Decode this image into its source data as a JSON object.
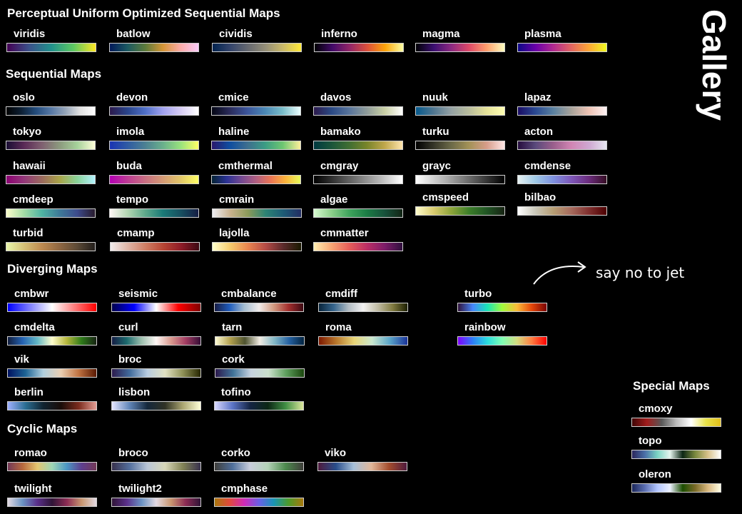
{
  "title": "Gallery",
  "annotation": "say no to jet",
  "sections": {
    "perceptual": "Perceptual Uniform Optimized Sequential Maps",
    "sequential": "Sequential Maps",
    "diverging": "Diverging Maps",
    "cyclic": "Cyclic Maps",
    "special": "Special Maps"
  },
  "colormaps": [
    {
      "name": "viridis",
      "colors": [
        "#440154",
        "#3b528b",
        "#21918c",
        "#5ec962",
        "#fde725"
      ]
    },
    {
      "name": "batlow",
      "colors": [
        "#011959",
        "#1c5a62",
        "#5c7b3b",
        "#d59537",
        "#fbaba8",
        "#faccfa"
      ]
    },
    {
      "name": "cividis",
      "colors": [
        "#00224e",
        "#35456c",
        "#666970",
        "#958f78",
        "#cbba69",
        "#fee838"
      ]
    },
    {
      "name": "inferno",
      "colors": [
        "#000004",
        "#420a68",
        "#932667",
        "#dd513a",
        "#fca50a",
        "#fcffa4"
      ]
    },
    {
      "name": "magma",
      "colors": [
        "#000004",
        "#3b0f70",
        "#8c2981",
        "#de4968",
        "#fe9f6d",
        "#fcfdbf"
      ]
    },
    {
      "name": "plasma",
      "colors": [
        "#0d0887",
        "#6a00a8",
        "#b12a90",
        "#e16462",
        "#fca636",
        "#f0f921"
      ]
    },
    {
      "name": "oslo",
      "colors": [
        "#010101",
        "#0d1f33",
        "#234c7c",
        "#5577a4",
        "#95a4b8",
        "#e2e2e2",
        "#ffffff"
      ]
    },
    {
      "name": "devon",
      "colors": [
        "#2c1a4c",
        "#29448a",
        "#4f6fc7",
        "#a1a2ef",
        "#d6ccf4",
        "#ffffff"
      ]
    },
    {
      "name": "cmice",
      "colors": [
        "#040613",
        "#2a2b5a",
        "#3c559b",
        "#4a87b5",
        "#79bdc9",
        "#eafdfd"
      ]
    },
    {
      "name": "davos",
      "colors": [
        "#2c1a4c",
        "#2b4a85",
        "#58749b",
        "#8f9c9a",
        "#c9d0a5",
        "#fefefe"
      ]
    },
    {
      "name": "nuuk",
      "colors": [
        "#05598c",
        "#507690",
        "#95a2a4",
        "#b9bd9d",
        "#e6e39a",
        "#fefeb2"
      ]
    },
    {
      "name": "lapaz",
      "colors": [
        "#1a0c64",
        "#2a4a92",
        "#5a81a0",
        "#a7a29a",
        "#eec3b4",
        "#fef2f3"
      ]
    },
    {
      "name": "tokyo",
      "colors": [
        "#1a0e34",
        "#5a2a56",
        "#7f6070",
        "#8c9a7e",
        "#a6d19a",
        "#fefed8"
      ]
    },
    {
      "name": "imola",
      "colors": [
        "#1a33b3",
        "#2f5ba3",
        "#4c8093",
        "#6ab08c",
        "#98e27d",
        "#ffff66"
      ]
    },
    {
      "name": "haline",
      "colors": [
        "#2a186c",
        "#0e4da0",
        "#3d6e8f",
        "#3b9c84",
        "#6dc671",
        "#fdef9a"
      ]
    },
    {
      "name": "bamako",
      "colors": [
        "#003940",
        "#1b553a",
        "#406e32",
        "#79852a",
        "#c0a74c",
        "#ffe5ad"
      ]
    },
    {
      "name": "turku",
      "colors": [
        "#000000",
        "#353528",
        "#6c6a48",
        "#a49257",
        "#d79d8a",
        "#ffe6e6"
      ]
    },
    {
      "name": "acton",
      "colors": [
        "#260d3e",
        "#5a4a7c",
        "#9a5f8c",
        "#d185b3",
        "#cfa7d1",
        "#e6e6f0"
      ]
    },
    {
      "name": "hawaii",
      "colors": [
        "#8c0273",
        "#94387a",
        "#9b6a5e",
        "#a9a449",
        "#8ad39a",
        "#b3f2fd"
      ]
    },
    {
      "name": "buda",
      "colors": [
        "#b301b3",
        "#bd3c94",
        "#c86f82",
        "#d49a75",
        "#e2c769",
        "#ffff66"
      ]
    },
    {
      "name": "cmthermal",
      "colors": [
        "#042333",
        "#2c3395",
        "#744992",
        "#b15f82",
        "#eb7655",
        "#fbb43c",
        "#e8fa5b"
      ]
    },
    {
      "name": "cmgray",
      "colors": [
        "#000000",
        "#3d3d3d",
        "#7a7a7a",
        "#b8b8b8",
        "#ffffff"
      ]
    },
    {
      "name": "grayc",
      "colors": [
        "#ffffff",
        "#b0b0b0",
        "#5a5a5a",
        "#000000"
      ]
    },
    {
      "name": "cmdense",
      "colors": [
        "#e6f1f1",
        "#9fc9e6",
        "#7f92e0",
        "#7e58b9",
        "#6c2d7e",
        "#360e24"
      ]
    },
    {
      "name": "cmdeep",
      "colors": [
        "#fdfecc",
        "#a3dca5",
        "#4fb4a3",
        "#3e7a98",
        "#3d4b8c",
        "#281a2c"
      ]
    },
    {
      "name": "tempo",
      "colors": [
        "#fff6f4",
        "#b3d6b2",
        "#5ea98b",
        "#1a7a77",
        "#175060",
        "#151d44"
      ]
    },
    {
      "name": "cmrain",
      "colors": [
        "#eeedf2",
        "#c9b28e",
        "#8b9a5a",
        "#2c8374",
        "#1d5b75",
        "#222d63"
      ]
    },
    {
      "name": "algae",
      "colors": [
        "#d7f9d0",
        "#8ccf8a",
        "#3fa35d",
        "#1b7c45",
        "#17513b",
        "#122414"
      ]
    },
    {
      "name": "cmspeed",
      "colors": [
        "#fffdcd",
        "#d9cb6f",
        "#8da43a",
        "#3c7e29",
        "#205524",
        "#172313"
      ]
    },
    {
      "name": "bilbao",
      "colors": [
        "#ffffff",
        "#c9c7b8",
        "#b69e74",
        "#a66b5d",
        "#80302f",
        "#4d0001"
      ]
    },
    {
      "name": "turbid",
      "colors": [
        "#e9f6ab",
        "#d5c076",
        "#be8a50",
        "#8f6742",
        "#5c4a36",
        "#221e1b"
      ]
    },
    {
      "name": "cmamp",
      "colors": [
        "#f1ecec",
        "#deb3a4",
        "#cd7c62",
        "#b64433",
        "#8d1b27",
        "#3c0912"
      ]
    },
    {
      "name": "lajolla",
      "colors": [
        "#ffffcc",
        "#f6ca6c",
        "#e9844f",
        "#b54b46",
        "#5a2a2b",
        "#1a1a00"
      ]
    },
    {
      "name": "cmmatter",
      "colors": [
        "#feedb0",
        "#f8a574",
        "#e65d59",
        "#bb2e65",
        "#7d1d69",
        "#2f0f3d"
      ]
    },
    {
      "name": "cmbwr",
      "colors": [
        "#0000ff",
        "#7f7fff",
        "#ffffff",
        "#ff7f7f",
        "#ff0000"
      ]
    },
    {
      "name": "seismic",
      "colors": [
        "#00004c",
        "#0000ff",
        "#ffffff",
        "#ff0000",
        "#7f0000"
      ]
    },
    {
      "name": "cmbalance",
      "colors": [
        "#181c43",
        "#1f5cbc",
        "#a5bdd1",
        "#f1eceb",
        "#d19a80",
        "#a42f2e",
        "#3c0912"
      ]
    },
    {
      "name": "cmdiff",
      "colors": [
        "#08243b",
        "#36658c",
        "#b1bbc3",
        "#f3f2f2",
        "#c1bca4",
        "#817b41",
        "#1c1f01"
      ]
    },
    {
      "name": "turbo",
      "colors": [
        "#30123b",
        "#4686fb",
        "#1ae4b6",
        "#a2fc3c",
        "#fabb39",
        "#e4460a",
        "#7a0403"
      ]
    },
    {
      "name": "cmdelta",
      "colors": [
        "#111d3d",
        "#2563b2",
        "#63b8c6",
        "#fffdcd",
        "#b5b63c",
        "#2d7a19",
        "#172313"
      ]
    },
    {
      "name": "curl",
      "colors": [
        "#151d44",
        "#1c6a6d",
        "#9dc0ae",
        "#fef6f4",
        "#d99a8f",
        "#a23d62",
        "#340d35"
      ]
    },
    {
      "name": "tarn",
      "colors": [
        "#fdfbd4",
        "#b3a14e",
        "#4e5330",
        "#f2ece3",
        "#82b7c5",
        "#2460a1",
        "#02233f"
      ]
    },
    {
      "name": "roma",
      "colors": [
        "#7e1900",
        "#b9792d",
        "#e8d578",
        "#cbe8ce",
        "#5ba6c9",
        "#1a3399"
      ]
    },
    {
      "name": "rainbow",
      "colors": [
        "#8000ff",
        "#2c7ef7",
        "#2adddd",
        "#80ffb4",
        "#d4dd80",
        "#ff7e41",
        "#ff0000"
      ]
    },
    {
      "name": "vik",
      "colors": [
        "#001261",
        "#1d6495",
        "#b0cfde",
        "#eacfb3",
        "#c07342",
        "#591902"
      ]
    },
    {
      "name": "broc",
      "colors": [
        "#2c1a4c",
        "#416b9c",
        "#b8cce0",
        "#e1e1c2",
        "#8f9157",
        "#262600"
      ]
    },
    {
      "name": "cork",
      "colors": [
        "#2c194c",
        "#407399",
        "#c6d2df",
        "#cbe0cc",
        "#5d9e5c",
        "#1a460d"
      ]
    },
    {
      "name": "berlin",
      "colors": [
        "#9eb0ff",
        "#2a6d92",
        "#102330",
        "#190c08",
        "#7a2b1d",
        "#e49e95"
      ]
    },
    {
      "name": "lisbon",
      "colors": [
        "#e5e5ff",
        "#5f84b6",
        "#14273b",
        "#303224",
        "#aaa571",
        "#ffffd8"
      ]
    },
    {
      "name": "tofino",
      "colors": [
        "#dad9ff",
        "#5b74c6",
        "#142443",
        "#0c2614",
        "#3f8e43",
        "#dbe69b"
      ]
    },
    {
      "name": "romao",
      "colors": [
        "#733957",
        "#b7693e",
        "#e4c671",
        "#9fd7b5",
        "#4b96c4",
        "#5e3f8e",
        "#733957"
      ]
    },
    {
      "name": "broco",
      "colors": [
        "#38314d",
        "#54709e",
        "#bac6d7",
        "#d8d7b8",
        "#828356",
        "#38314d"
      ]
    },
    {
      "name": "corko",
      "colors": [
        "#3f3e3a",
        "#4f6f9b",
        "#c9cedc",
        "#b3d2b6",
        "#4d8a4e",
        "#3f3e3a"
      ]
    },
    {
      "name": "viko",
      "colors": [
        "#4f1a3d",
        "#294e8b",
        "#a6bfd8",
        "#e2b89a",
        "#a44d2d",
        "#4f1a3d"
      ]
    },
    {
      "name": "twilight",
      "colors": [
        "#e2d9e2",
        "#6a92c2",
        "#5a2f8a",
        "#2f1436",
        "#8c2b54",
        "#c89670",
        "#e2d9e2"
      ]
    },
    {
      "name": "twilight2",
      "colors": [
        "#2f1436",
        "#5a2f8a",
        "#6a92c2",
        "#e2d9e2",
        "#c89670",
        "#8c2b54",
        "#2f1436"
      ]
    },
    {
      "name": "cmphase",
      "colors": [
        "#a8780d",
        "#e24a3c",
        "#cf2ab8",
        "#6a5fe6",
        "#1895b4",
        "#4c9a2a",
        "#a8780d"
      ]
    },
    {
      "name": "cmoxy",
      "colors": [
        "#3f0505",
        "#a11c1c",
        "#585858",
        "#bcbcbc",
        "#ffffff",
        "#e8e24a",
        "#e1bf1a"
      ]
    },
    {
      "name": "topo",
      "colors": [
        "#29265b",
        "#4a6fa8",
        "#7bd4c4",
        "#e6f5ef",
        "#0c2614",
        "#7b8a3f",
        "#d8c28b",
        "#ffffff"
      ]
    },
    {
      "name": "oleron",
      "colors": [
        "#1a2659",
        "#5b6eb0",
        "#b3c6ff",
        "#ecf1ff",
        "#1a4c00",
        "#7a6a28",
        "#d9b87f",
        "#fdfde6"
      ]
    }
  ]
}
